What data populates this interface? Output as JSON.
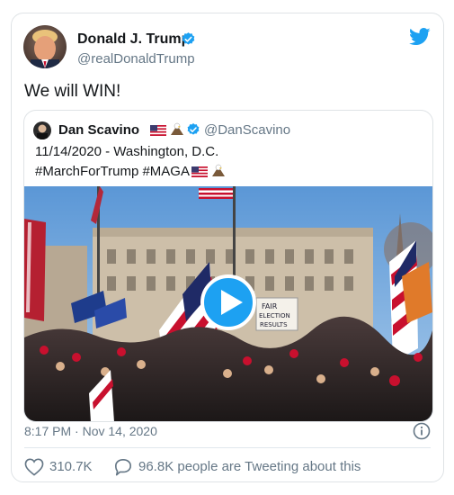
{
  "tweet": {
    "author_name": "Donald J. Trump",
    "author_handle": "@realDonaldTrump",
    "text": "We will WIN!",
    "timestamp": "8:17 PM · Nov 14, 2020",
    "likes": "310.7K",
    "conversation": "96.8K people are Tweeting about this",
    "verified": true
  },
  "quoted_tweet": {
    "author_name": "Dan Scavino",
    "author_handle": "@DanScavino",
    "line1": "11/14/2020 - Washington, D.C.",
    "line2": "#MarchForTrump #MAGA",
    "verified": true,
    "media": {
      "type": "video",
      "sign_text": "FAIR ELECTION ... RESULTS",
      "overlay_icon": "play-icon"
    }
  },
  "icons": {
    "verified": "verified-badge-icon",
    "twitter": "twitter-bird-icon",
    "info": "info-icon",
    "like": "heart-icon",
    "reply": "speech-bubble-icon"
  },
  "colors": {
    "accent": "#1da1f2",
    "text_primary": "#14171a",
    "text_secondary": "#657786",
    "border": "#dfe3e6"
  }
}
